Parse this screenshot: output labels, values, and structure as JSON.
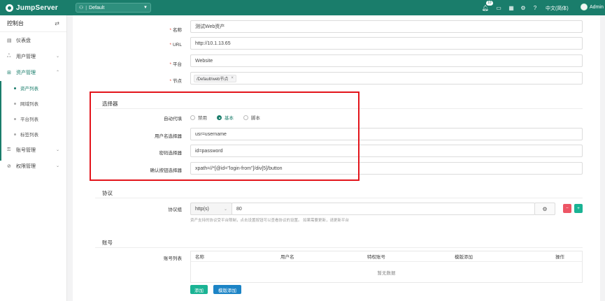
{
  "topbar": {
    "brand": "JumpServer",
    "org_value": "Default",
    "notification_count": "10",
    "language": "中文(简体)",
    "user": "Admin"
  },
  "sidebar": {
    "title": "控制台",
    "items": [
      {
        "label": "仪表盘",
        "icon": "dashboard-icon"
      },
      {
        "label": "用户管理",
        "icon": "users-icon"
      },
      {
        "label": "资产管理",
        "icon": "assets-icon"
      },
      {
        "label": "账号管理",
        "icon": "accounts-icon"
      },
      {
        "label": "权限管理",
        "icon": "permissions-icon"
      }
    ],
    "subitems": [
      "资产列表",
      "网域列表",
      "平台列表",
      "标签列表"
    ]
  },
  "form": {
    "name_label": "名称",
    "name_value": "测试Web资产",
    "url_label": "URL",
    "url_value": "http://10.1.13.65",
    "platform_label": "平台",
    "platform_value": "Website",
    "node_label": "节点",
    "node_tag": "/Default/web节点"
  },
  "selector": {
    "title": "选择器",
    "autofill_label": "自动代填",
    "options": [
      "禁用",
      "基本",
      "脚本"
    ],
    "selected": "基本",
    "username_label": "用户名选择器",
    "username_value": "usr=username",
    "password_label": "密码选择器",
    "password_value": "id=password",
    "submit_label": "确认按钮选择器",
    "submit_value": "xpath=//*[@id=\"login-from\"]/div[5]/button"
  },
  "protocol": {
    "title": "协议",
    "group_label": "协议组",
    "name": "http(s)",
    "port": "80",
    "hint": "资产支持的协议受平台限制，点击设置按钮可以查看协议的设置。 如果需要更新，请更新平台"
  },
  "account": {
    "title": "账号",
    "list_label": "账号列表",
    "columns": [
      "名称",
      "用户名",
      "特权账号",
      "模版添加",
      "操作"
    ],
    "empty_text": "暂无数据",
    "add_button": "添加",
    "template_add_button": "模版添加"
  },
  "colors": {
    "brand": "#1a7d6b",
    "highlight": "#e3141b",
    "danger": "#ed5565",
    "success": "#1ab394",
    "primary": "#1c84c6"
  }
}
